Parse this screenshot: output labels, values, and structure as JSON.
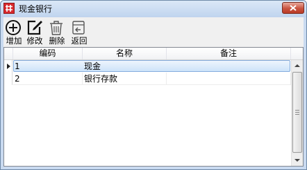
{
  "window": {
    "title": "现金银行"
  },
  "toolbar": {
    "add_label": "增加",
    "edit_label": "修改",
    "delete_label": "删除",
    "back_label": "返回"
  },
  "grid": {
    "columns": [
      "编码",
      "名称",
      "备注"
    ],
    "rows": [
      {
        "code": "1",
        "name": "现金",
        "note": ""
      },
      {
        "code": "2",
        "name": "银行存款",
        "note": ""
      }
    ],
    "selected_row": 0
  },
  "icons": {
    "app": "table-grid-icon",
    "close": "close-icon",
    "add": "plus-circle-icon",
    "edit": "edit-pencil-icon",
    "delete": "trash-icon",
    "back": "return-icon",
    "row_indicator": "row-pointer-icon"
  },
  "colors": {
    "selection": "#cde3f9",
    "close_button": "#c9533f",
    "app_icon": "#d8282b"
  }
}
